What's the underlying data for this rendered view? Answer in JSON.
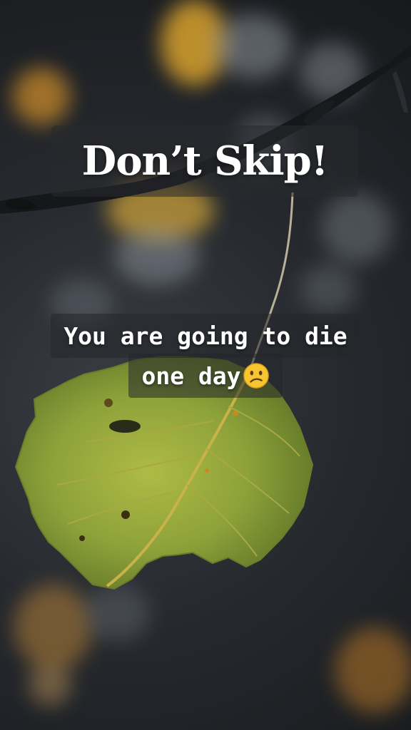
{
  "title": "Don’t Skip!",
  "caption": {
    "line1": "You are going to die",
    "line2": "one day"
  },
  "emoji": "confused-face-emoji",
  "colors": {
    "leaf": "#8fa23a",
    "branch": "#15171a",
    "bokeh_gold": "#d8a22e"
  }
}
